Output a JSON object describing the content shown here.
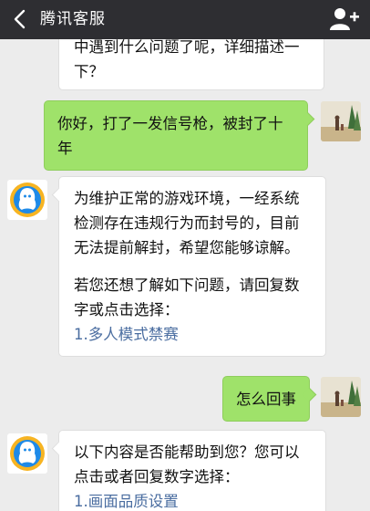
{
  "header": {
    "back_icon": "chevron-left-icon",
    "title": "腾讯客服",
    "add_icon": "add-person-icon"
  },
  "messages": [
    {
      "sender": "service",
      "lines": [
        "中遇到什么问题了呢，详细描述一",
        "下？"
      ]
    },
    {
      "sender": "user",
      "lines": [
        "你好，打了一发信号枪，被封了十",
        "年"
      ]
    },
    {
      "sender": "service",
      "para1": [
        "为维护正常的游戏环境，一经系统",
        "检测存在违规行为而封号的，目前",
        "无法提前解封，希望您能够谅解。"
      ],
      "para2": [
        "若您还想了解如下问题，请回复数",
        "字或点击选择："
      ],
      "options": [
        "1.多人模式禁赛"
      ]
    },
    {
      "sender": "user",
      "lines": [
        "怎么回事"
      ]
    },
    {
      "sender": "service",
      "para1": [
        "以下内容是否能帮助到您？您可以",
        "点击或者回复数字选择："
      ],
      "options": [
        "1.画面品质设置"
      ]
    }
  ],
  "colors": {
    "topbar": "#2e2e32",
    "background": "#ececec",
    "user_bubble": "#9fe26a",
    "service_bubble": "#ffffff",
    "link": "#4a6da0"
  }
}
